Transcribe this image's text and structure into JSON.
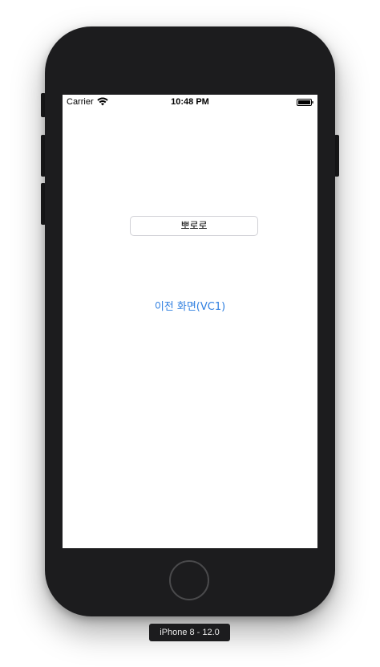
{
  "status_bar": {
    "carrier": "Carrier",
    "time": "10:48 PM",
    "wifi_icon": "wifi-icon",
    "battery_icon": "battery-icon"
  },
  "main": {
    "text_field_value": "뽀로로",
    "back_button_label": "이전 화면(VC1)"
  },
  "simulator": {
    "device_label": "iPhone 8 - 12.0"
  },
  "colors": {
    "link": "#2f7fe0",
    "device_body": "#1c1c1e"
  }
}
